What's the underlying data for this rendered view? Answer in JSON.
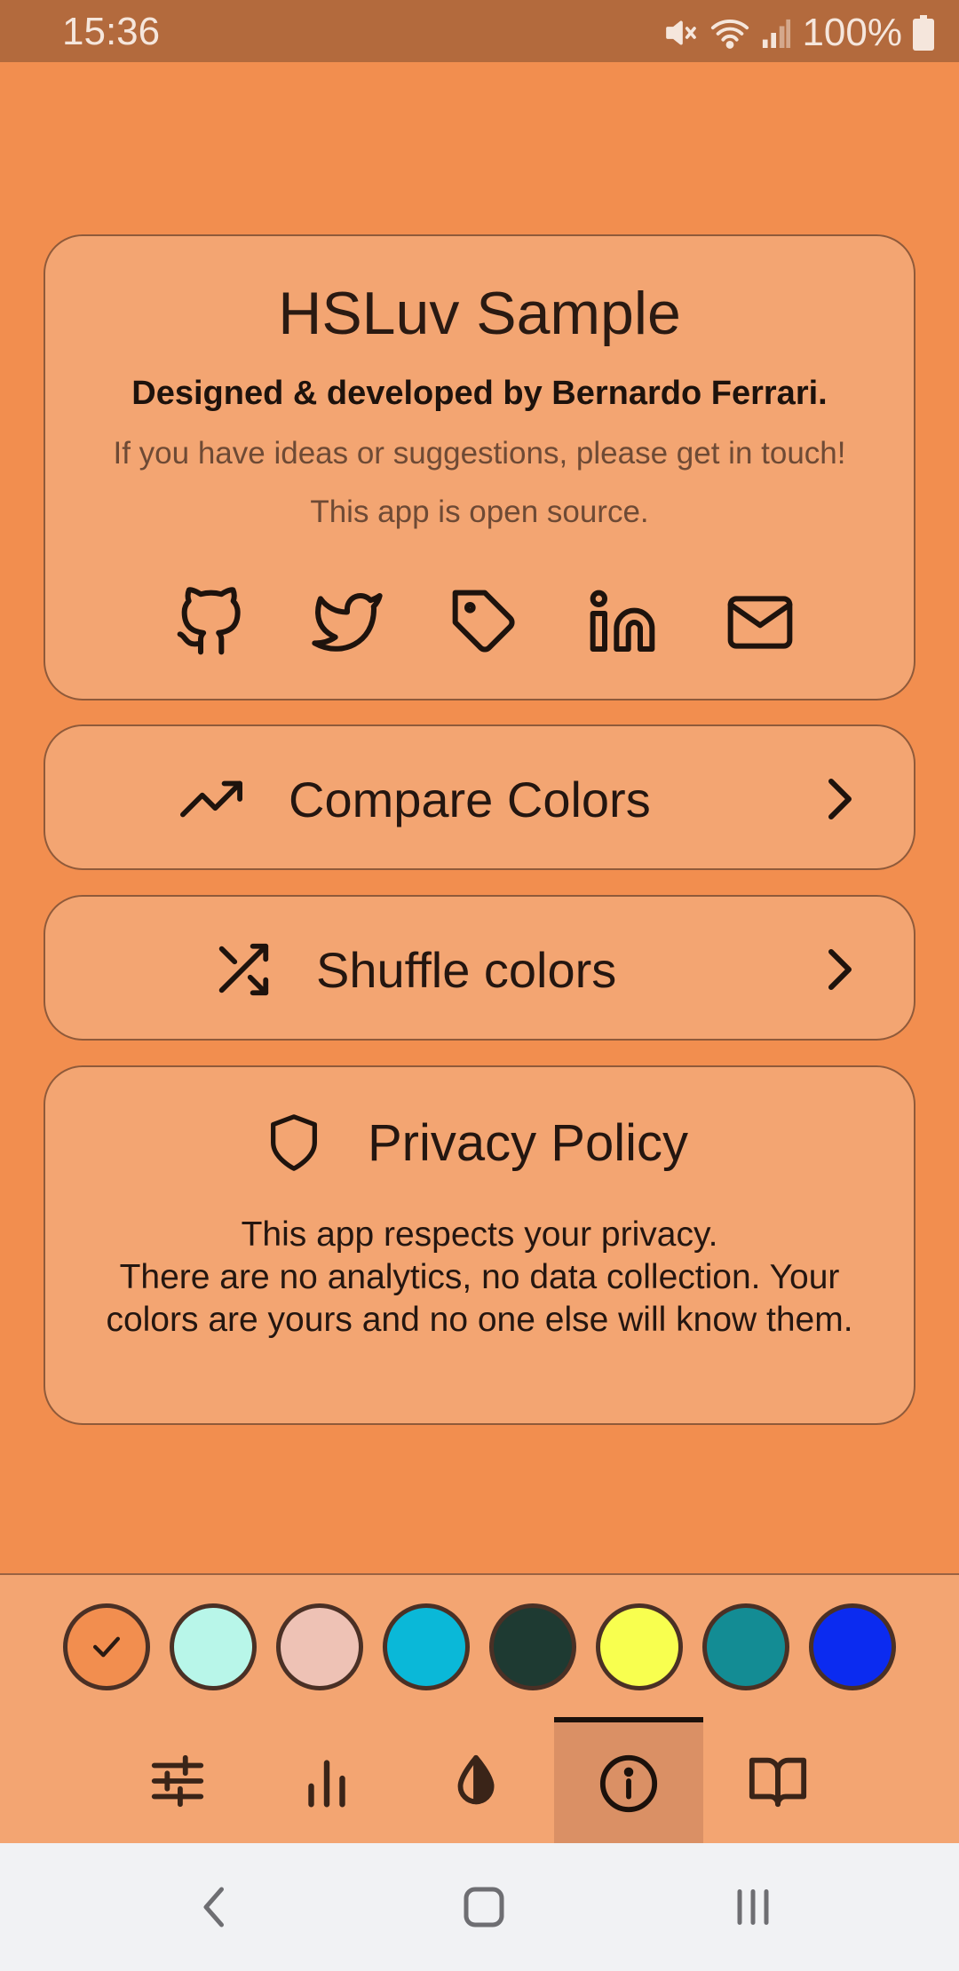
{
  "status_bar": {
    "time": "15:36",
    "battery": "100%"
  },
  "about": {
    "title": "HSLuv Sample",
    "subtitle": "Designed & developed by Bernardo Ferrari.",
    "line1": "If you have ideas or suggestions, please get in touch!",
    "line2": "This app is open source.",
    "socials": [
      "github-icon",
      "twitter-icon",
      "tag-icon",
      "linkedin-icon",
      "mail-icon"
    ]
  },
  "compare": {
    "label": "Compare Colors",
    "icon": "trending-up-icon"
  },
  "shuffle": {
    "label": "Shuffle colors",
    "icon": "shuffle-icon"
  },
  "privacy": {
    "title": "Privacy Policy",
    "text_line1": "This app respects your privacy.",
    "text_line2": "There are no analytics, no data collection. Your colors are yours and no one else will know them."
  },
  "palette": {
    "swatches": [
      "#F28E4F",
      "#B8F6E9",
      "#EEC2B5",
      "#0AB8D8",
      "#1E3A32",
      "#F8FF4F",
      "#138C94",
      "#0B2BF0"
    ],
    "selected_index": 0
  },
  "tabs": [
    "sliders-icon",
    "bar-chart-icon",
    "contrast-icon",
    "info-icon",
    "book-icon"
  ],
  "active_tab_index": 3,
  "colors": {
    "background": "#F28E4F",
    "card": "#F3A572",
    "status_bar": "#B36A3D",
    "text": "#2A1A12"
  }
}
